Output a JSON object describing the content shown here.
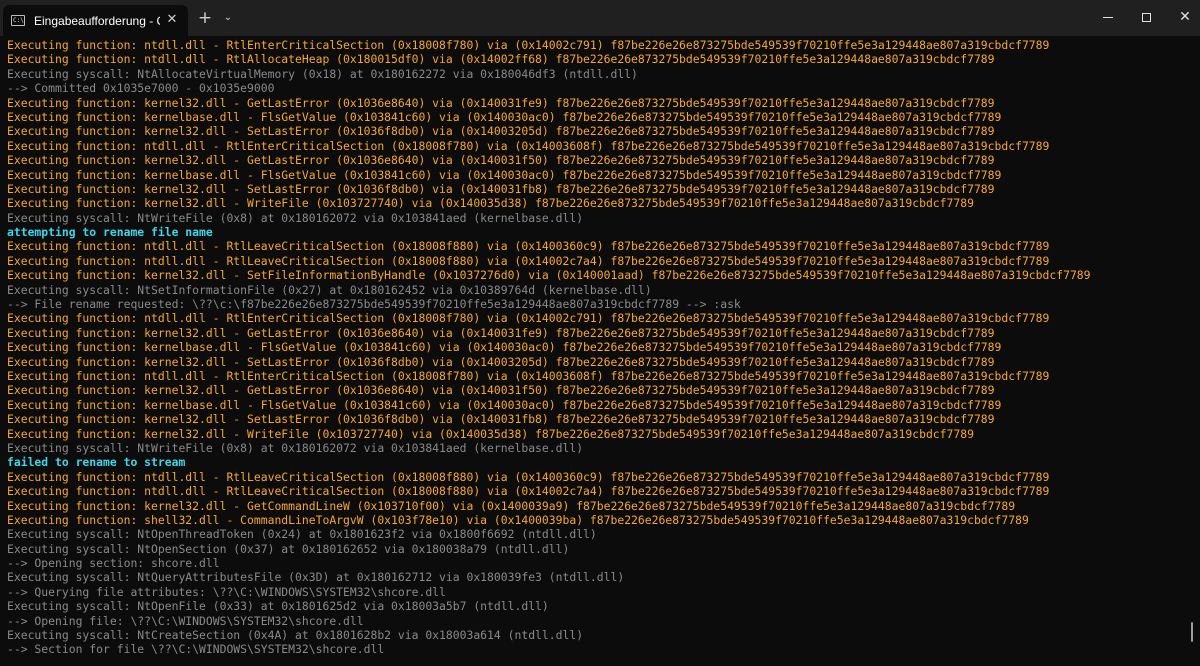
{
  "titlebar": {
    "tab_title": "Eingabeaufforderung - C:\\Use",
    "tab_icon_text": "C:\\",
    "tab_close": "✕",
    "new_tab": "+",
    "tab_dropdown": "⌄",
    "minimize_icon": "minimize-icon",
    "maximize_icon": "maximize-icon",
    "close_icon": "✕"
  },
  "colors": {
    "background": "#0c0c0c",
    "exec_function": "#f9a825",
    "syscall": "#8a8a8a",
    "status": "#3bd7ea"
  },
  "console": {
    "lines": [
      {
        "type": "yellow",
        "text": "Executing function: ntdll.dll - RtlEnterCriticalSection (0x18008f780) via (0x14002c791) f87be226e26e873275bde549539f70210ffe5e3a129448ae807a319cbdcf7789"
      },
      {
        "type": "yellow",
        "text": "Executing function: ntdll.dll - RtlAllocateHeap (0x180015df0) via (0x14002ff68) f87be226e26e873275bde549539f70210ffe5e3a129448ae807a319cbdcf7789"
      },
      {
        "type": "gray",
        "text": "Executing syscall: NtAllocateVirtualMemory (0x18) at 0x180162272 via 0x180046df3 (ntdll.dll)"
      },
      {
        "type": "gray",
        "text": "--> Committed 0x1035e7000 - 0x1035e9000"
      },
      {
        "type": "yellow",
        "text": "Executing function: kernel32.dll - GetLastError (0x1036e8640) via (0x140031fe9) f87be226e26e873275bde549539f70210ffe5e3a129448ae807a319cbdcf7789"
      },
      {
        "type": "yellow",
        "text": "Executing function: kernelbase.dll - FlsGetValue (0x103841c60) via (0x140030ac0) f87be226e26e873275bde549539f70210ffe5e3a129448ae807a319cbdcf7789"
      },
      {
        "type": "yellow",
        "text": "Executing function: kernel32.dll - SetLastError (0x1036f8db0) via (0x14003205d) f87be226e26e873275bde549539f70210ffe5e3a129448ae807a319cbdcf7789"
      },
      {
        "type": "yellow",
        "text": "Executing function: ntdll.dll - RtlEnterCriticalSection (0x18008f780) via (0x14003608f) f87be226e26e873275bde549539f70210ffe5e3a129448ae807a319cbdcf7789"
      },
      {
        "type": "yellow",
        "text": "Executing function: kernel32.dll - GetLastError (0x1036e8640) via (0x140031f50) f87be226e26e873275bde549539f70210ffe5e3a129448ae807a319cbdcf7789"
      },
      {
        "type": "yellow",
        "text": "Executing function: kernelbase.dll - FlsGetValue (0x103841c60) via (0x140030ac0) f87be226e26e873275bde549539f70210ffe5e3a129448ae807a319cbdcf7789"
      },
      {
        "type": "yellow",
        "text": "Executing function: kernel32.dll - SetLastError (0x1036f8db0) via (0x140031fb8) f87be226e26e873275bde549539f70210ffe5e3a129448ae807a319cbdcf7789"
      },
      {
        "type": "yellow",
        "text": "Executing function: kernel32.dll - WriteFile (0x103727740) via (0x140035d38) f87be226e26e873275bde549539f70210ffe5e3a129448ae807a319cbdcf7789"
      },
      {
        "type": "gray",
        "text": "Executing syscall: NtWriteFile (0x8) at 0x180162072 via 0x103841aed (kernelbase.dll)"
      },
      {
        "type": "cyan",
        "text": "attempting to rename file name"
      },
      {
        "type": "yellow",
        "text": "Executing function: ntdll.dll - RtlLeaveCriticalSection (0x18008f880) via (0x1400360c9) f87be226e26e873275bde549539f70210ffe5e3a129448ae807a319cbdcf7789"
      },
      {
        "type": "yellow",
        "text": "Executing function: ntdll.dll - RtlLeaveCriticalSection (0x18008f880) via (0x14002c7a4) f87be226e26e873275bde549539f70210ffe5e3a129448ae807a319cbdcf7789"
      },
      {
        "type": "yellow",
        "text": "Executing function: kernel32.dll - SetFileInformationByHandle (0x1037276d0) via (0x140001aad) f87be226e26e873275bde549539f70210ffe5e3a129448ae807a319cbdcf7789"
      },
      {
        "type": "gray",
        "text": "Executing syscall: NtSetInformationFile (0x27) at 0x180162452 via 0x10389764d (kernelbase.dll)"
      },
      {
        "type": "gray",
        "text": "--> File rename requested: \\??\\c:\\f87be226e26e873275bde549539f70210ffe5e3a129448ae807a319cbdcf7789 --> :ask"
      },
      {
        "type": "yellow",
        "text": "Executing function: ntdll.dll - RtlEnterCriticalSection (0x18008f780) via (0x14002c791) f87be226e26e873275bde549539f70210ffe5e3a129448ae807a319cbdcf7789"
      },
      {
        "type": "yellow",
        "text": "Executing function: kernel32.dll - GetLastError (0x1036e8640) via (0x140031fe9) f87be226e26e873275bde549539f70210ffe5e3a129448ae807a319cbdcf7789"
      },
      {
        "type": "yellow",
        "text": "Executing function: kernelbase.dll - FlsGetValue (0x103841c60) via (0x140030ac0) f87be226e26e873275bde549539f70210ffe5e3a129448ae807a319cbdcf7789"
      },
      {
        "type": "yellow",
        "text": "Executing function: kernel32.dll - SetLastError (0x1036f8db0) via (0x14003205d) f87be226e26e873275bde549539f70210ffe5e3a129448ae807a319cbdcf7789"
      },
      {
        "type": "yellow",
        "text": "Executing function: ntdll.dll - RtlEnterCriticalSection (0x18008f780) via (0x14003608f) f87be226e26e873275bde549539f70210ffe5e3a129448ae807a319cbdcf7789"
      },
      {
        "type": "yellow",
        "text": "Executing function: kernel32.dll - GetLastError (0x1036e8640) via (0x140031f50) f87be226e26e873275bde549539f70210ffe5e3a129448ae807a319cbdcf7789"
      },
      {
        "type": "yellow",
        "text": "Executing function: kernelbase.dll - FlsGetValue (0x103841c60) via (0x140030ac0) f87be226e26e873275bde549539f70210ffe5e3a129448ae807a319cbdcf7789"
      },
      {
        "type": "yellow",
        "text": "Executing function: kernel32.dll - SetLastError (0x1036f8db0) via (0x140031fb8) f87be226e26e873275bde549539f70210ffe5e3a129448ae807a319cbdcf7789"
      },
      {
        "type": "yellow",
        "text": "Executing function: kernel32.dll - WriteFile (0x103727740) via (0x140035d38) f87be226e26e873275bde549539f70210ffe5e3a129448ae807a319cbdcf7789"
      },
      {
        "type": "gray",
        "text": "Executing syscall: NtWriteFile (0x8) at 0x180162072 via 0x103841aed (kernelbase.dll)"
      },
      {
        "type": "cyan",
        "text": "failed to rename to stream"
      },
      {
        "type": "yellow",
        "text": "Executing function: ntdll.dll - RtlLeaveCriticalSection (0x18008f880) via (0x1400360c9) f87be226e26e873275bde549539f70210ffe5e3a129448ae807a319cbdcf7789"
      },
      {
        "type": "yellow",
        "text": "Executing function: ntdll.dll - RtlLeaveCriticalSection (0x18008f880) via (0x14002c7a4) f87be226e26e873275bde549539f70210ffe5e3a129448ae807a319cbdcf7789"
      },
      {
        "type": "yellow",
        "text": "Executing function: kernel32.dll - GetCommandLineW (0x103710f00) via (0x1400039a9) f87be226e26e873275bde549539f70210ffe5e3a129448ae807a319cbdcf7789"
      },
      {
        "type": "yellow",
        "text": "Executing function: shell32.dll - CommandLineToArgvW (0x103f78e10) via (0x1400039ba) f87be226e26e873275bde549539f70210ffe5e3a129448ae807a319cbdcf7789"
      },
      {
        "type": "gray",
        "text": "Executing syscall: NtOpenThreadToken (0x24) at 0x1801623f2 via 0x1800f6692 (ntdll.dll)"
      },
      {
        "type": "gray",
        "text": "Executing syscall: NtOpenSection (0x37) at 0x180162652 via 0x180038a79 (ntdll.dll)"
      },
      {
        "type": "gray",
        "text": "--> Opening section: shcore.dll"
      },
      {
        "type": "gray",
        "text": "Executing syscall: NtQueryAttributesFile (0x3D) at 0x180162712 via 0x180039fe3 (ntdll.dll)"
      },
      {
        "type": "gray",
        "text": "--> Querying file attributes: \\??\\C:\\WINDOWS\\SYSTEM32\\shcore.dll"
      },
      {
        "type": "gray",
        "text": "Executing syscall: NtOpenFile (0x33) at 0x1801625d2 via 0x18003a5b7 (ntdll.dll)"
      },
      {
        "type": "gray",
        "text": "--> Opening file: \\??\\C:\\WINDOWS\\SYSTEM32\\shcore.dll"
      },
      {
        "type": "gray",
        "text": "Executing syscall: NtCreateSection (0x4A) at 0x1801628b2 via 0x18003a614 (ntdll.dll)"
      },
      {
        "type": "gray",
        "text": "--> Section for file \\??\\C:\\WINDOWS\\SYSTEM32\\shcore.dll"
      }
    ]
  }
}
